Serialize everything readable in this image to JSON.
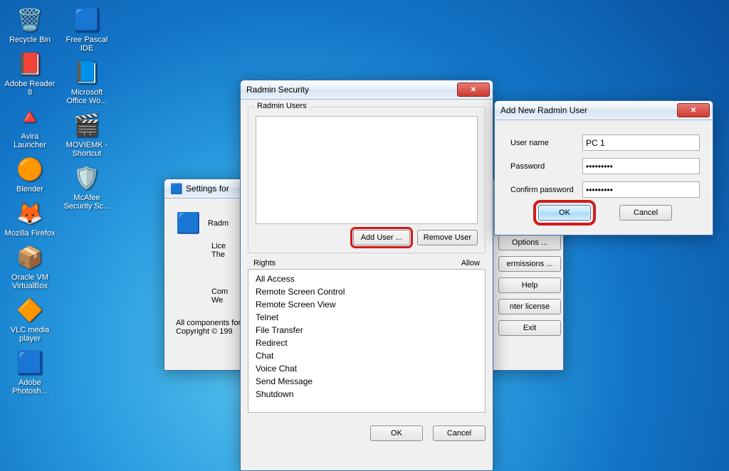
{
  "desktop_icons_col1": [
    {
      "label": "Recycle Bin",
      "glyph": "🗑️"
    },
    {
      "label": "Adobe Reader 8",
      "glyph": "📕"
    },
    {
      "label": "Avira Launcher",
      "glyph": "🔺"
    },
    {
      "label": "Blender",
      "glyph": "🟠"
    },
    {
      "label": "Mozilla Firefox",
      "glyph": "🦊"
    },
    {
      "label": "Oracle VM VirtualBox",
      "glyph": "📦"
    },
    {
      "label": "VLC media player",
      "glyph": "🔶"
    },
    {
      "label": "Adobe Photosh...",
      "glyph": "🟦"
    }
  ],
  "desktop_icons_col2": [
    {
      "label": "Free Pascal IDE",
      "glyph": "🟦"
    },
    {
      "label": "Microsoft Office Wo...",
      "glyph": "📘"
    },
    {
      "label": "MOVIEMK - Shortcut",
      "glyph": "🎬"
    },
    {
      "label": "McAfee Security Sc...",
      "glyph": "🛡️"
    }
  ],
  "settings_window": {
    "title": "Settings for",
    "header": "Radm",
    "line1": "Lice",
    "line2": "The",
    "line3": "Com",
    "line4": "We",
    "footer1": "All components for",
    "footer2": "Copyright © 199",
    "buttons": [
      "Options ...",
      "ermissions ...",
      "Help",
      "nter license",
      "Exit"
    ]
  },
  "security_window": {
    "title": "Radmin Security",
    "group_label": "Radmin Users",
    "add_user": "Add User ...",
    "remove_user": "Remove User",
    "rights_label": "Rights",
    "allow_label": "Allow",
    "rights": [
      "All Access",
      "Remote Screen Control",
      "Remote Screen View",
      "Telnet",
      "File Transfer",
      "Redirect",
      "Chat",
      "Voice Chat",
      "Send Message",
      "Shutdown"
    ],
    "ok": "OK",
    "cancel": "Cancel"
  },
  "add_user_window": {
    "title": "Add New Radmin User",
    "username_label": "User name",
    "username_value": "PC 1",
    "password_label": "Password",
    "password_value": "•••••••••",
    "confirm_label": "Confirm password",
    "confirm_value": "•••••••••",
    "ok": "OK",
    "cancel": "Cancel"
  }
}
